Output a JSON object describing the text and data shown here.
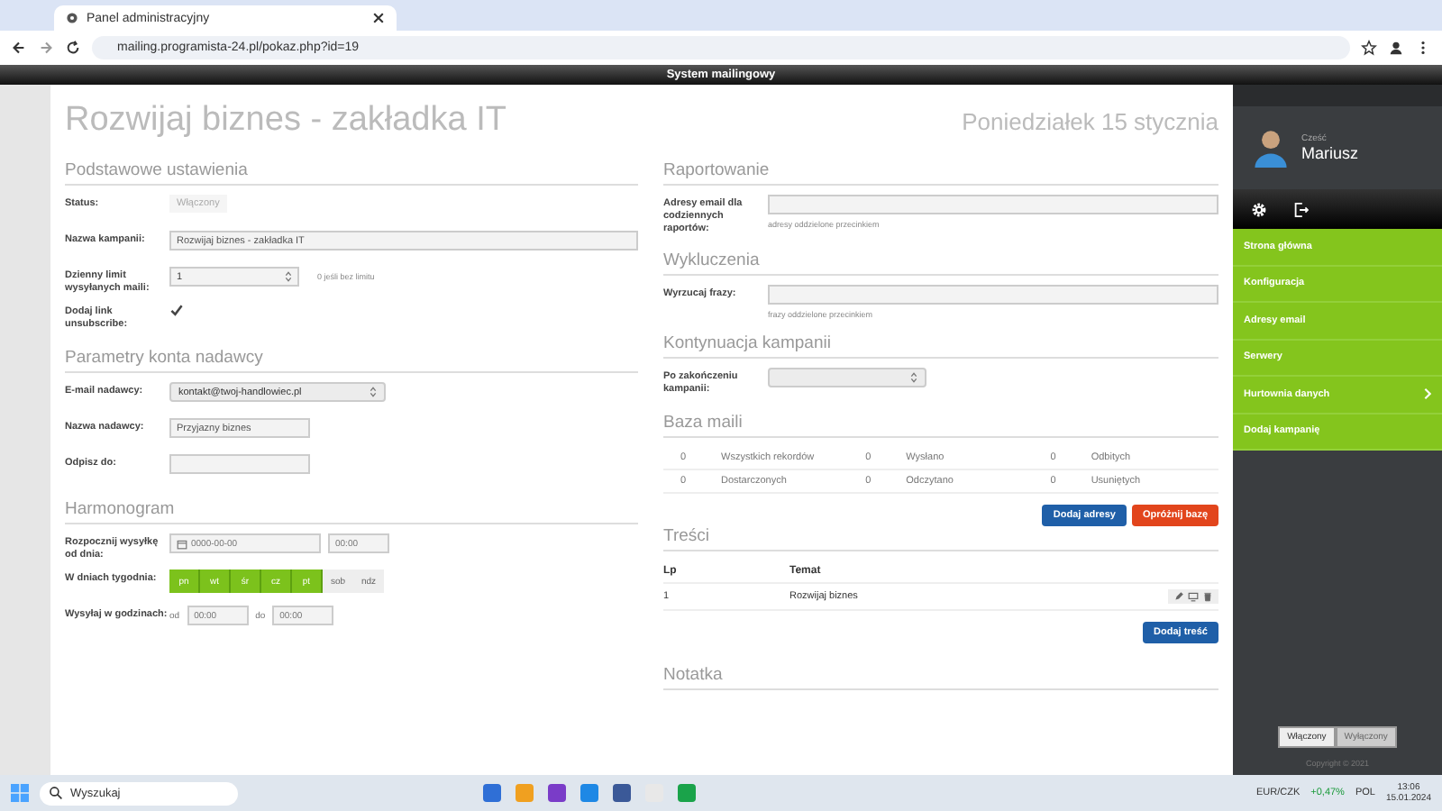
{
  "browser": {
    "tab_title": "Panel administracyjny",
    "url": "mailing.programista-24.pl/pokaz.php?id=19"
  },
  "header": {
    "title": "System mailingowy"
  },
  "page": {
    "title": "Rozwijaj biznes - zakładka IT",
    "date": "Poniedziałek 15 stycznia"
  },
  "left_sections": [
    {
      "heading": "Podstawowe ustawienia",
      "rows": [
        {
          "kind": "status",
          "label": "Status:",
          "value": "Włączony"
        },
        {
          "kind": "text",
          "label": "Nazwa kampanii:",
          "value": "Rozwijaj biznes - zakładka IT"
        },
        {
          "kind": "number",
          "label": "Dzienny limit wysyłanych maili:",
          "value": "1",
          "hint": "0 jeśli bez limitu"
        },
        {
          "kind": "checkbox",
          "label": "Dodaj link unsubscribe:",
          "checked": true
        }
      ]
    },
    {
      "heading": "Parametry konta nadawcy",
      "rows": [
        {
          "kind": "select",
          "label": "E-mail nadawcy:",
          "value": "kontakt@twoj-handlowiec.pl"
        },
        {
          "kind": "short",
          "label": "Nazwa nadawcy:",
          "value": "Przyjazny biznes"
        },
        {
          "kind": "short",
          "label": "Odpisz do:",
          "value": ""
        }
      ]
    },
    {
      "heading": "Harmonogram",
      "rows": [
        {
          "kind": "datetime",
          "label": "Rozpocznij wysyłkę od dnia:",
          "date": "0000-00-00",
          "time": "00:00"
        },
        {
          "kind": "days",
          "label": "W dniach tygodnia:",
          "days": [
            {
              "label": "pn",
              "selected": true
            },
            {
              "label": "wt",
              "selected": true
            },
            {
              "label": "śr",
              "selected": true
            },
            {
              "label": "cz",
              "selected": true
            },
            {
              "label": "pt",
              "selected": true
            },
            {
              "label": "sob",
              "selected": false
            },
            {
              "label": "ndz",
              "selected": false
            }
          ]
        },
        {
          "kind": "timerange",
          "label": "Wysyłaj w godzinach:",
          "from_label": "od",
          "from": "00:00",
          "to_label": "do",
          "to": "00:00"
        }
      ]
    }
  ],
  "right_sections": [
    {
      "heading": "Raportowanie",
      "rows": [
        {
          "kind": "text",
          "label": "Adresy email dla codziennych raportów:",
          "value": "",
          "hint": "adresy oddzielone przecinkiem"
        }
      ]
    },
    {
      "heading": "Wykluczenia",
      "rows": [
        {
          "kind": "text",
          "label": "Wyrzucaj frazy:",
          "value": "",
          "hint": "frazy oddzielone przecinkiem"
        }
      ]
    },
    {
      "heading": "Kontynuacja kampanii",
      "rows": [
        {
          "kind": "select",
          "label": "Po zakończeniu kampanii:",
          "value": ""
        }
      ]
    }
  ],
  "mail_base": {
    "heading": "Baza maili",
    "stats": [
      {
        "count": "0",
        "label": "Wszystkich rekordów"
      },
      {
        "count": "0",
        "label": "Wysłano"
      },
      {
        "count": "0",
        "label": "Odbitych"
      },
      {
        "count": "0",
        "label": "Dostarczonych"
      },
      {
        "count": "0",
        "label": "Odczytano"
      },
      {
        "count": "0",
        "label": "Usuniętych"
      }
    ],
    "buttons": [
      {
        "label": "Dodaj adresy",
        "kind": "primary"
      },
      {
        "label": "Opróżnij bazę",
        "kind": "danger"
      }
    ]
  },
  "contents": {
    "heading": "Treści",
    "columns": [
      "Lp",
      "Temat"
    ],
    "rows": [
      {
        "lp": "1",
        "subject": "Rozwijaj biznes"
      }
    ],
    "button": "Dodaj treść"
  },
  "note": {
    "heading": "Notatka"
  },
  "sidebar": {
    "greeting": "Cześć",
    "user": "Mariusz",
    "items": [
      {
        "label": "Strona główna",
        "has_submenu": false
      },
      {
        "label": "Konfiguracja",
        "has_submenu": false
      },
      {
        "label": "Adresy email",
        "has_submenu": false
      },
      {
        "label": "Serwery",
        "has_submenu": false
      },
      {
        "label": "Hurtownia danych",
        "has_submenu": true
      },
      {
        "label": "Dodaj kampanię",
        "has_submenu": false
      }
    ],
    "toggle": [
      {
        "label": "Włączony",
        "selected": true
      },
      {
        "label": "Wyłączony",
        "selected": false
      }
    ],
    "copyright": "Copyright © 2021"
  },
  "taskbar": {
    "search": "Wyszukaj",
    "ticker": "EUR/CZK",
    "change": "+0,47%",
    "language": "POL",
    "time": "13:06",
    "date": "15.01.2024"
  }
}
